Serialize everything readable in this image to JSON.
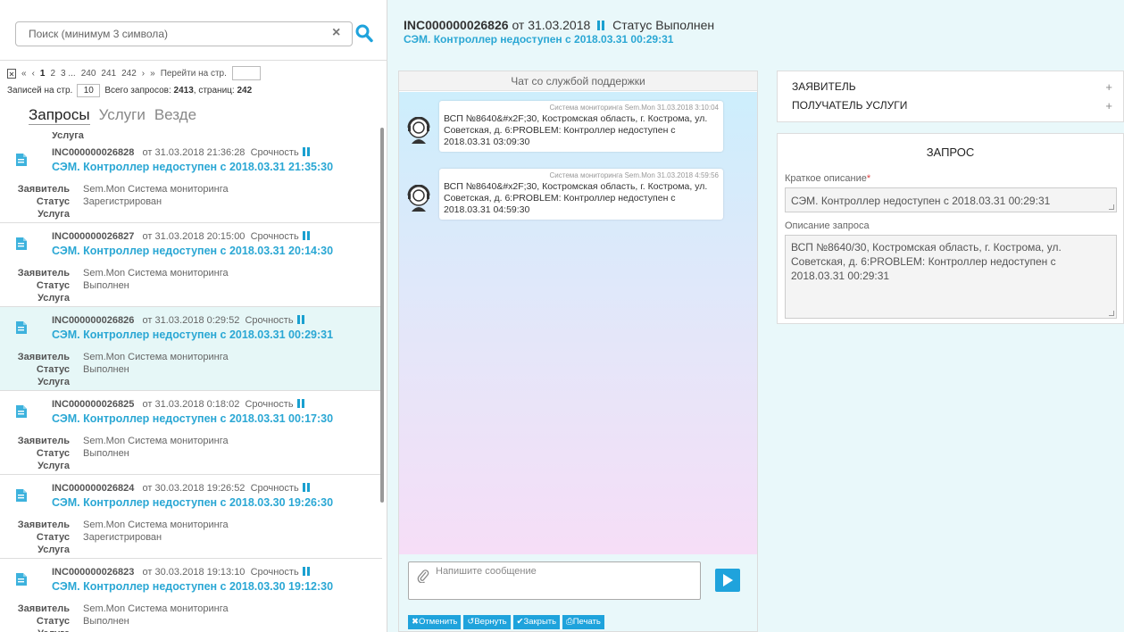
{
  "search": {
    "placeholder": "Поиск (минимум 3 символа)",
    "clear_icon": "×"
  },
  "pager": {
    "first": "«",
    "prev": "‹",
    "pages": [
      "1",
      "2",
      "3 ...",
      "240",
      "241",
      "242"
    ],
    "next": "›",
    "last": "»",
    "goto_label": "Перейти на стр.",
    "per_page_label": "Записей на стр.",
    "per_page_value": "10",
    "total_label": "Всего запросов:",
    "total_value": "2413",
    "pages_label": ", страниц:",
    "pages_value": "242"
  },
  "tabs": [
    "Запросы",
    "Услуги",
    "Везде"
  ],
  "list_partial_label": "Услуга",
  "field_labels": {
    "requester": "Заявитель",
    "status": "Статус",
    "service": "Услуга"
  },
  "list": [
    {
      "num": "INC000000026828",
      "date": "от 31.03.2018 21:36:28",
      "urgency_label": "Срочность",
      "title": "СЭМ. Контроллер недоступен с 2018.03.31 21:35:30",
      "requester": "Sem.Mon Система мониторинга",
      "status": "Зарегистрирован",
      "selected": false
    },
    {
      "num": "INC000000026827",
      "date": "от 31.03.2018 20:15:00",
      "urgency_label": "Срочность",
      "title": "СЭМ. Контроллер недоступен с 2018.03.31 20:14:30",
      "requester": "Sem.Mon Система мониторинга",
      "status": "Выполнен",
      "selected": false
    },
    {
      "num": "INC000000026826",
      "date": "от 31.03.2018 0:29:52",
      "urgency_label": "Срочность",
      "title": "СЭМ. Контроллер недоступен с 2018.03.31 00:29:31",
      "requester": "Sem.Mon Система мониторинга",
      "status": "Выполнен",
      "selected": true
    },
    {
      "num": "INC000000026825",
      "date": "от 31.03.2018 0:18:02",
      "urgency_label": "Срочность",
      "title": "СЭМ. Контроллер недоступен с 2018.03.31 00:17:30",
      "requester": "Sem.Mon Система мониторинга",
      "status": "Выполнен",
      "selected": false
    },
    {
      "num": "INC000000026824",
      "date": "от 30.03.2018 19:26:52",
      "urgency_label": "Срочность",
      "title": "СЭМ. Контроллер недоступен с 2018.03.30 19:26:30",
      "requester": "Sem.Mon Система мониторинга",
      "status": "Зарегистрирован",
      "selected": false
    },
    {
      "num": "INC000000026823",
      "date": "от 30.03.2018 19:13:10",
      "urgency_label": "Срочность",
      "title": "СЭМ. Контроллер недоступен с 2018.03.30 19:12:30",
      "requester": "Sem.Mon Система мониторинга",
      "status": "Выполнен",
      "selected": false
    }
  ],
  "ticket": {
    "id": "INC000000026826",
    "date": "от 31.03.2018",
    "status_label": "Статус",
    "status": "Выполнен",
    "title": "СЭМ. Контроллер недоступен с 2018.03.31 00:29:31"
  },
  "chat": {
    "title": "Чат со службой поддержки",
    "messages": [
      {
        "meta": "Система мониторинга Sem.Mon 31.03.2018 3:10:04",
        "text": "ВСП №8640&#x2F;30, Костромская область, г. Кострома, ул. Советская, д. 6:PROBLEM: Контроллер недоступен с 2018.03.31 03:09:30"
      },
      {
        "meta": "Система мониторинга Sem.Mon 31.03.2018 4:59:56",
        "text": "ВСП №8640&#x2F;30, Костромская область, г. Кострома, ул. Советская, д. 6:PROBLEM: Контроллер недоступен с 2018.03.31 04:59:30"
      }
    ],
    "input_placeholder": "Напишите сообщение",
    "actions": [
      "✖Отменить",
      "↺Вернуть",
      "✔Закрыть",
      "⎙Печать"
    ]
  },
  "people": {
    "requester": "ЗАЯВИТЕЛЬ",
    "recipient": "ПОЛУЧАТЕЛЬ УСЛУГИ",
    "expand": "+"
  },
  "request": {
    "title": "ЗАПРОС",
    "short_label": "Краткое описание",
    "required_mark": "*",
    "short_value": "СЭМ. Контроллер недоступен с 2018.03.31 00:29:31",
    "desc_label": "Описание запроса",
    "desc_value": "ВСП №8640/30, Костромская область, г. Кострома, ул. Советская, д. 6:PROBLEM: Контроллер недоступен с 2018.03.31 00:29:31"
  },
  "colors": {
    "accent": "#1fa3dc",
    "link": "#2aa7d4",
    "selected_row": "#e6f7f7",
    "panel_bg": "#e9f8fa"
  }
}
